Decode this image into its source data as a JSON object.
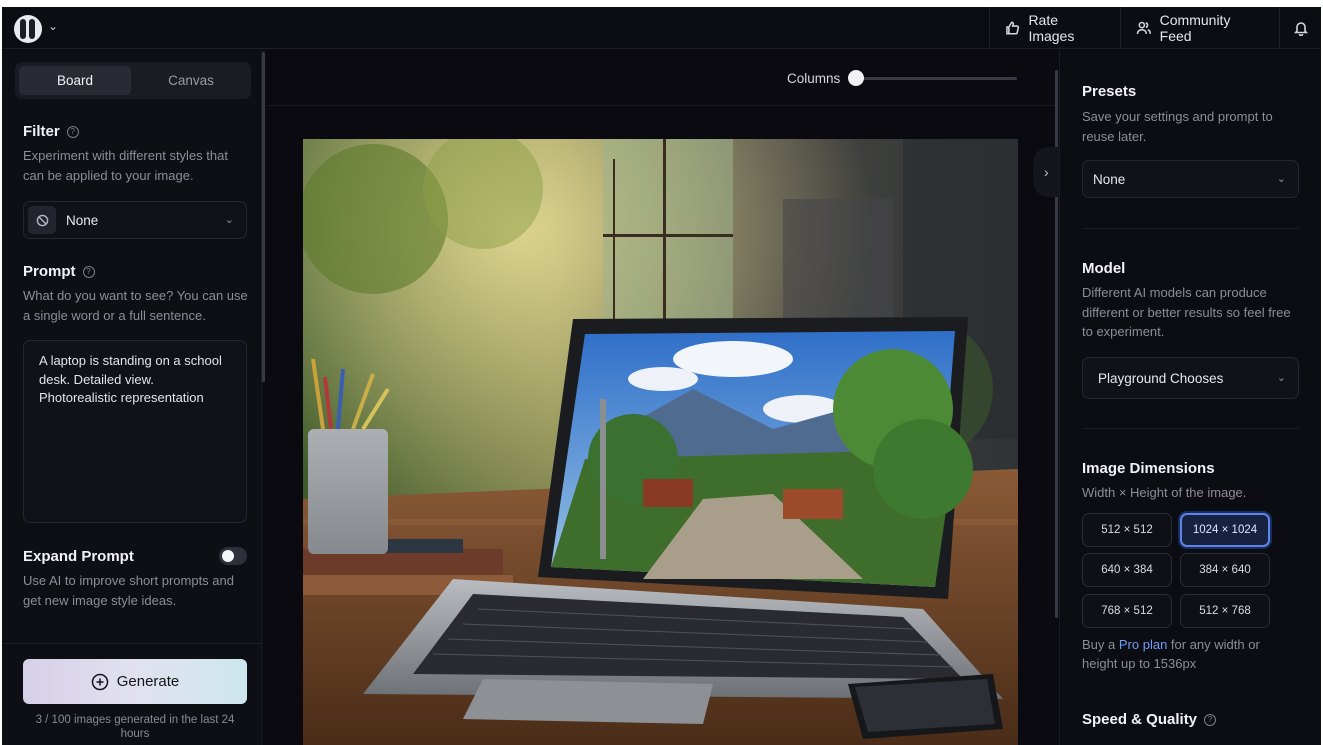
{
  "topbar": {
    "rate_label": "Rate Images",
    "community_label": "Community Feed"
  },
  "left": {
    "tabs": [
      {
        "label": "Board",
        "active": true
      },
      {
        "label": "Canvas",
        "active": false
      }
    ],
    "filter": {
      "title": "Filter",
      "description": "Experiment with different styles that can be applied to your image.",
      "value": "None"
    },
    "prompt": {
      "title": "Prompt",
      "description": "What do you want to see? You can use a single word or a full sentence.",
      "text": "A laptop is standing on a school desk. Detailed view. Photorealistic representation"
    },
    "expand": {
      "title": "Expand Prompt",
      "description": "Use AI to improve short prompts and get new image style ideas.",
      "enabled": false
    },
    "generate_label": "Generate",
    "usage_note": "3 / 100 images generated in the last 24 hours"
  },
  "center": {
    "columns_label": "Columns",
    "columns_value": 1,
    "image_alt": "Laptop on wooden desk with mountain landscape on screen"
  },
  "right": {
    "presets": {
      "title": "Presets",
      "description": "Save your settings and prompt to reuse later.",
      "value": "None"
    },
    "model": {
      "title": "Model",
      "description": "Different AI models can produce different or better results so feel free to experiment.",
      "value": "Playground Chooses"
    },
    "dimensions": {
      "title": "Image Dimensions",
      "description": "Width × Height of the image.",
      "options": [
        {
          "label": "512 × 512",
          "selected": false
        },
        {
          "label": "1024 × 1024",
          "selected": true
        },
        {
          "label": "640 × 384",
          "selected": false
        },
        {
          "label": "384 × 640",
          "selected": false
        },
        {
          "label": "768 × 512",
          "selected": false
        },
        {
          "label": "512 × 768",
          "selected": false
        }
      ],
      "pro_prefix": "Buy a",
      "pro_link": "Pro plan",
      "pro_suffix": "for any width or height up to 1536px"
    },
    "speed": {
      "title": "Speed & Quality"
    }
  },
  "colors": {
    "background": "#0b0b12",
    "accent_selected": "#5f84e8",
    "link": "#6e9cf2"
  }
}
